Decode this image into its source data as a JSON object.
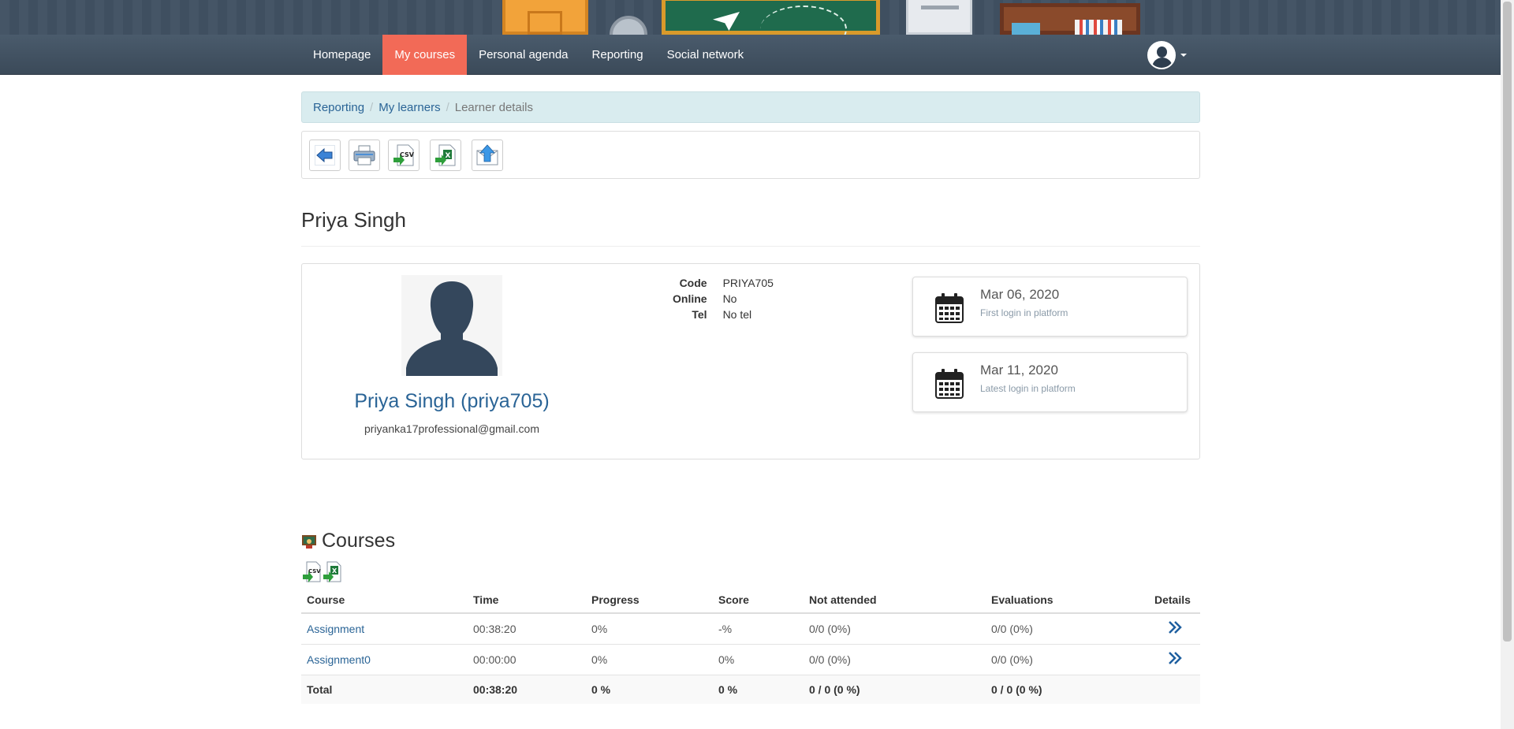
{
  "nav": {
    "items": [
      "Homepage",
      "My courses",
      "Personal agenda",
      "Reporting",
      "Social network"
    ],
    "active_index": 1
  },
  "breadcrumb": {
    "items": [
      "Reporting",
      "My learners"
    ],
    "current": "Learner details"
  },
  "toolbar": {
    "buttons": [
      "back-icon",
      "print-icon",
      "csv-export-icon",
      "excel-export-icon",
      "send-message-icon"
    ],
    "csv_text": "CSV"
  },
  "learner": {
    "title": "Priya Singh",
    "full_name": "Priya Singh (priya705)",
    "email": "priyanka17professional@gmail.com",
    "code_label": "Code",
    "code_value": "PRIYA705",
    "online_label": "Online",
    "online_value": "No",
    "tel_label": "Tel",
    "tel_value": "No tel",
    "first_login_date": "Mar 06, 2020",
    "first_login_desc": "First login in platform",
    "latest_login_date": "Mar 11, 2020",
    "latest_login_desc": "Latest login in platform"
  },
  "courses": {
    "title": "Courses",
    "csv_text": "CSV",
    "headers": [
      "Course",
      "Time",
      "Progress",
      "Score",
      "Not attended",
      "Evaluations",
      "Details"
    ],
    "rows": [
      {
        "course": "Assignment",
        "time": "00:38:20",
        "progress": "0%",
        "score": "-%",
        "not_attended": "0/0 (0%)",
        "evaluations": "0/0 (0%)"
      },
      {
        "course": "Assignment0",
        "time": "00:00:00",
        "progress": "0%",
        "score": "0%",
        "not_attended": "0/0 (0%)",
        "evaluations": "0/0 (0%)"
      }
    ],
    "total": {
      "label": "Total",
      "time": "00:38:20",
      "progress": "0 %",
      "score": "0 %",
      "not_attended": "0 / 0 (0 %)",
      "evaluations": "0 / 0 (0 %)"
    }
  },
  "colors": {
    "nav_active": "#f26a57",
    "link": "#2a6496",
    "navbar": "#3f4f60"
  }
}
